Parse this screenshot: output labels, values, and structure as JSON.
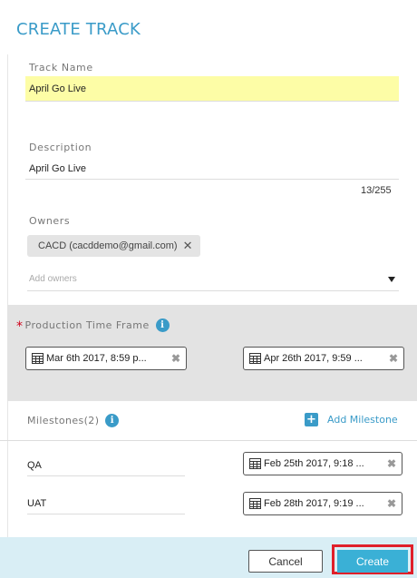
{
  "header": {
    "title": "CREATE TRACK"
  },
  "track_name": {
    "label": "Track Name",
    "value": "April Go Live"
  },
  "description": {
    "label": "Description",
    "value": "April Go Live",
    "count": "13/255"
  },
  "owners": {
    "label": "Owners",
    "chips": [
      {
        "label": "CACD (cacddemo@gmail.com)",
        "close": "✕"
      }
    ],
    "placeholder": "Add owners"
  },
  "timeframe": {
    "required_mark": "*",
    "label": "Production Time Frame",
    "start": "Mar 6th 2017, 8:59 p...",
    "end": "Apr 26th 2017, 9:59 ..."
  },
  "milestones": {
    "label": "Milestones(2)",
    "add_label": "Add Milestone",
    "items": [
      {
        "name": "QA",
        "date": "Feb 25th 2017, 9:18 ..."
      },
      {
        "name": "UAT",
        "date": "Feb 28th 2017, 9:19 ..."
      }
    ]
  },
  "footer": {
    "cancel_label": "Cancel",
    "create_label": "Create"
  },
  "colors": {
    "accent": "#3a9bc8",
    "highlight": "#fdfda6",
    "required": "#d0021b",
    "outline": "#e0202a"
  }
}
